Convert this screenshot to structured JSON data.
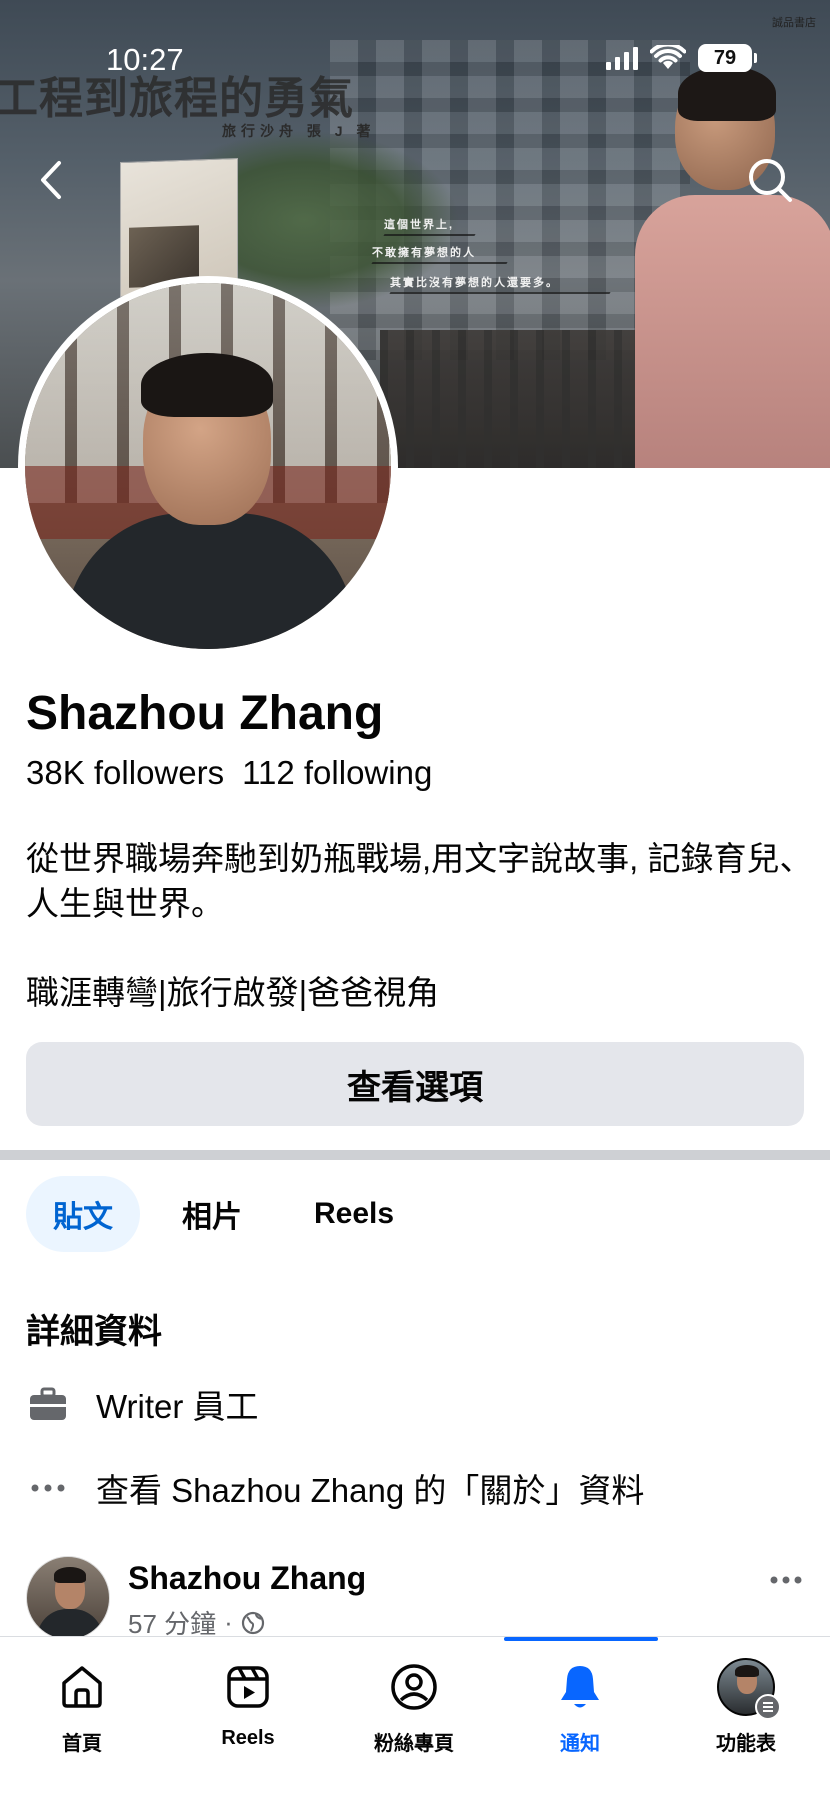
{
  "status_bar": {
    "time": "10:27",
    "battery": "79"
  },
  "cover": {
    "book_title": "工程到旅程的勇氣",
    "book_author": "旅行沙舟 張 J 著",
    "quote_lines": [
      "這個世界上,",
      "不敢擁有夢想的人",
      "其實比沒有夢想的人還要多。"
    ],
    "corner_text": "誠品書店"
  },
  "profile": {
    "name": "Shazhou Zhang",
    "followers": "38K followers",
    "following": "112 following",
    "bio": "從世界職場奔馳到奶瓶戰場,用文字說故事, 記錄育兒、人生與世界。",
    "tags": "職涯轉彎|旅行啟發|爸爸視角",
    "options_button": "查看選項"
  },
  "tabs": [
    {
      "label": "貼文",
      "active": true
    },
    {
      "label": "相片",
      "active": false
    },
    {
      "label": "Reels",
      "active": false
    }
  ],
  "details": {
    "title": "詳細資料",
    "work": "Writer 員工",
    "about": "查看 Shazhou Zhang 的「關於」資料"
  },
  "post": {
    "author": "Shazhou Zhang",
    "time": "57 分鐘"
  },
  "bottom_nav": [
    {
      "label": "首頁",
      "icon": "home-icon"
    },
    {
      "label": "Reels",
      "icon": "reels-icon"
    },
    {
      "label": "粉絲專頁",
      "icon": "fanpage-icon"
    },
    {
      "label": "通知",
      "icon": "bell-icon",
      "active": true
    },
    {
      "label": "功能表",
      "icon": "menu-avatar"
    }
  ],
  "colors": {
    "accent": "#0866ff",
    "active_tab_bg": "#ebf5ff",
    "active_tab_text": "#0064d1",
    "button_bg": "#e4e6eb",
    "secondary_text": "#65676b"
  }
}
